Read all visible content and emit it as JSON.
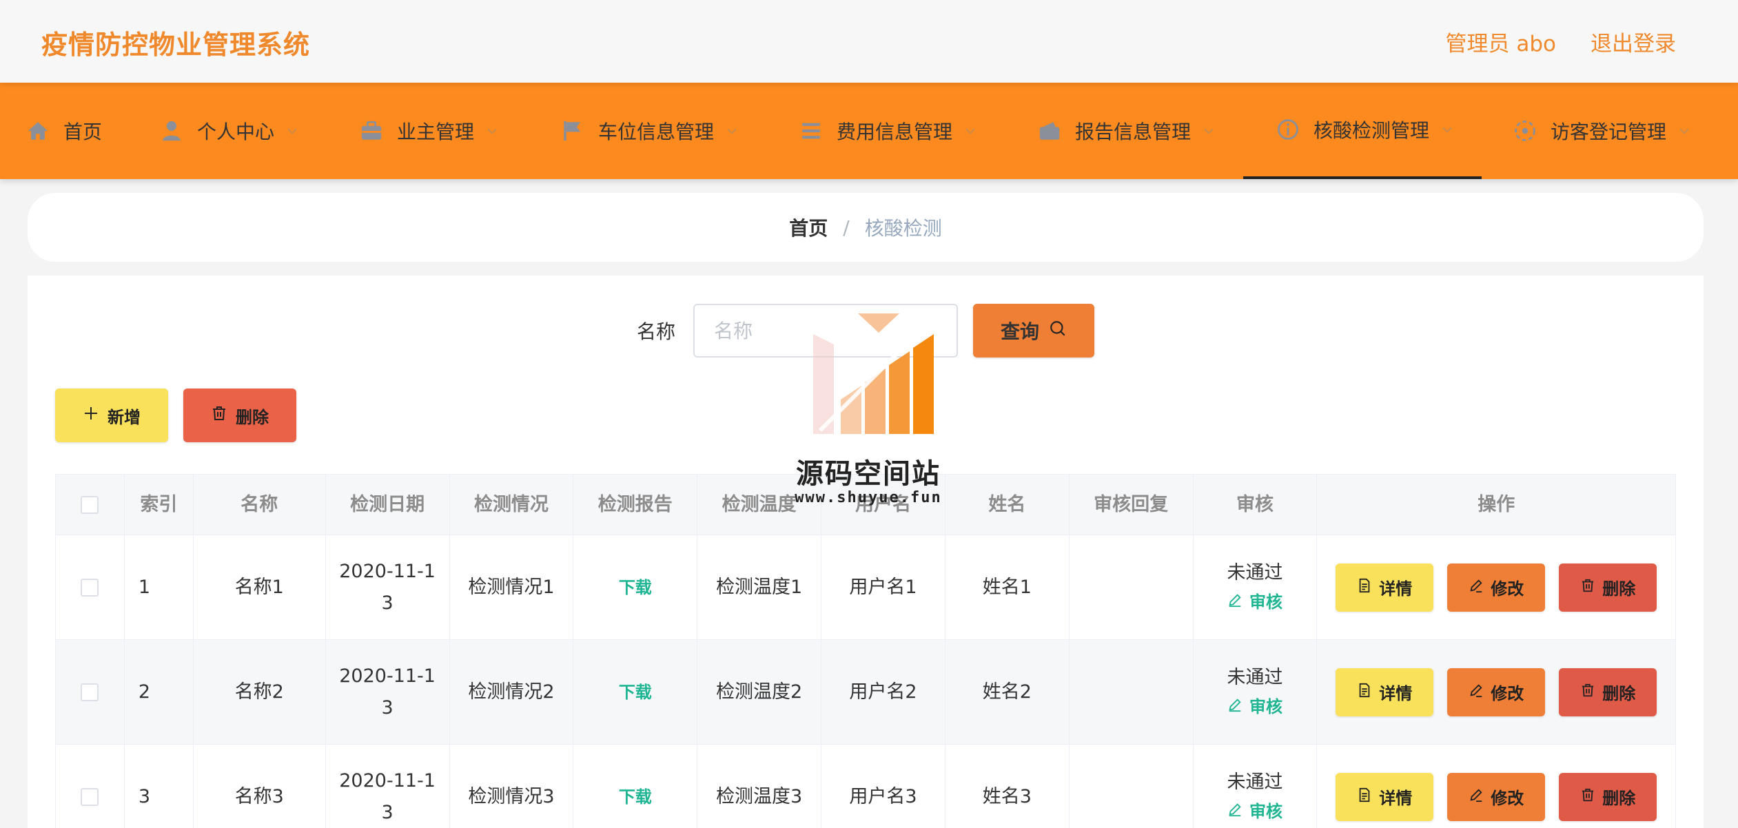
{
  "header": {
    "title": "疫情防控物业管理系统",
    "user_label": "管理员 abo",
    "logout_label": "退出登录",
    "accent_color": "#f0892c"
  },
  "nav": {
    "background_color": "#fd8a1f",
    "items": [
      {
        "label": "首页",
        "icon": "home-icon",
        "has_dropdown": false,
        "active": false
      },
      {
        "label": "个人中心",
        "icon": "user-icon",
        "has_dropdown": true,
        "active": false
      },
      {
        "label": "业主管理",
        "icon": "briefcase-icon",
        "has_dropdown": true,
        "active": false
      },
      {
        "label": "车位信息管理",
        "icon": "flag-icon",
        "has_dropdown": true,
        "active": false
      },
      {
        "label": "费用信息管理",
        "icon": "list-icon",
        "has_dropdown": true,
        "active": false
      },
      {
        "label": "报告信息管理",
        "icon": "wallet-icon",
        "has_dropdown": true,
        "active": false
      },
      {
        "label": "核酸检测管理",
        "icon": "info-icon",
        "has_dropdown": true,
        "active": true
      },
      {
        "label": "访客登记管理",
        "icon": "loading-icon",
        "has_dropdown": true,
        "active": false
      }
    ]
  },
  "breadcrumb": {
    "home": "首页",
    "separator": "/",
    "current": "核酸检测"
  },
  "search": {
    "label": "名称",
    "placeholder": "名称",
    "value": "",
    "button_label": "查询"
  },
  "actions": {
    "add_label": "新增",
    "delete_label": "删除"
  },
  "table": {
    "columns": [
      "索引",
      "名称",
      "检测日期",
      "检测情况",
      "检测报告",
      "检测温度",
      "用户名",
      "姓名",
      "审核回复",
      "审核",
      "操作"
    ],
    "rows": [
      {
        "index": "1",
        "name": "名称1",
        "date_line1": "2020-11-1",
        "date_line2": "3",
        "situation": "检测情况1",
        "report": "下载",
        "temperature": "检测温度1",
        "username": "用户名1",
        "realname": "姓名1",
        "reply": "",
        "audit_status": "未通过",
        "audit_action": "审核"
      },
      {
        "index": "2",
        "name": "名称2",
        "date_line1": "2020-11-1",
        "date_line2": "3",
        "situation": "检测情况2",
        "report": "下载",
        "temperature": "检测温度2",
        "username": "用户名2",
        "realname": "姓名2",
        "reply": "",
        "audit_status": "未通过",
        "audit_action": "审核"
      },
      {
        "index": "3",
        "name": "名称3",
        "date_line1": "2020-11-1",
        "date_line2": "3",
        "situation": "检测情况3",
        "report": "下载",
        "temperature": "检测温度3",
        "username": "用户名3",
        "realname": "姓名3",
        "reply": "",
        "audit_status": "未通过",
        "audit_action": "审核"
      }
    ],
    "row_actions": {
      "detail": "详情",
      "edit": "修改",
      "delete": "删除"
    }
  },
  "watermark": {
    "title": "源码空间站",
    "url": "www.shuyue.fun"
  }
}
